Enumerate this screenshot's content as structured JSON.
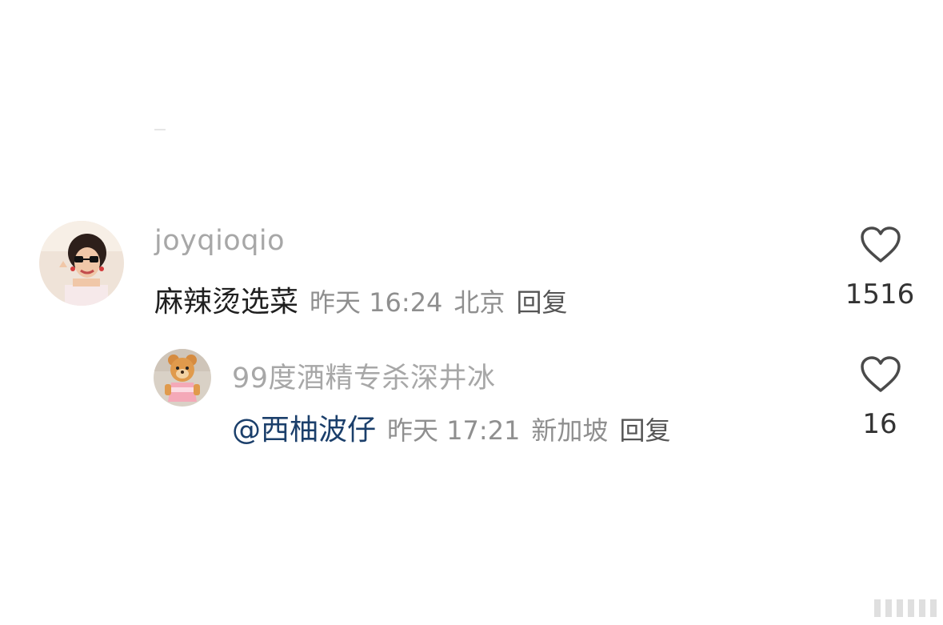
{
  "comments": [
    {
      "username": "joyqioqio",
      "text": "麻辣烫选菜",
      "time": "昨天 16:24",
      "location": "北京",
      "reply_label": "回复",
      "likes": "1516",
      "avatar_icon": "profile-photo-woman-sunglasses"
    }
  ],
  "replies": [
    {
      "username": "99度酒精专杀深井冰",
      "mention": "@西柚波仔",
      "time": "昨天 17:21",
      "location": "新加坡",
      "reply_label": "回复",
      "likes": "16",
      "avatar_icon": "profile-photo-bear-mascot"
    }
  ],
  "icons": {
    "like": "heart-outline-icon"
  },
  "colors": {
    "background": "#ffffff",
    "username": "#a7a7a7",
    "meta": "#8f8f8f",
    "mention": "#1b3f6b",
    "text": "#1f1f1f"
  }
}
